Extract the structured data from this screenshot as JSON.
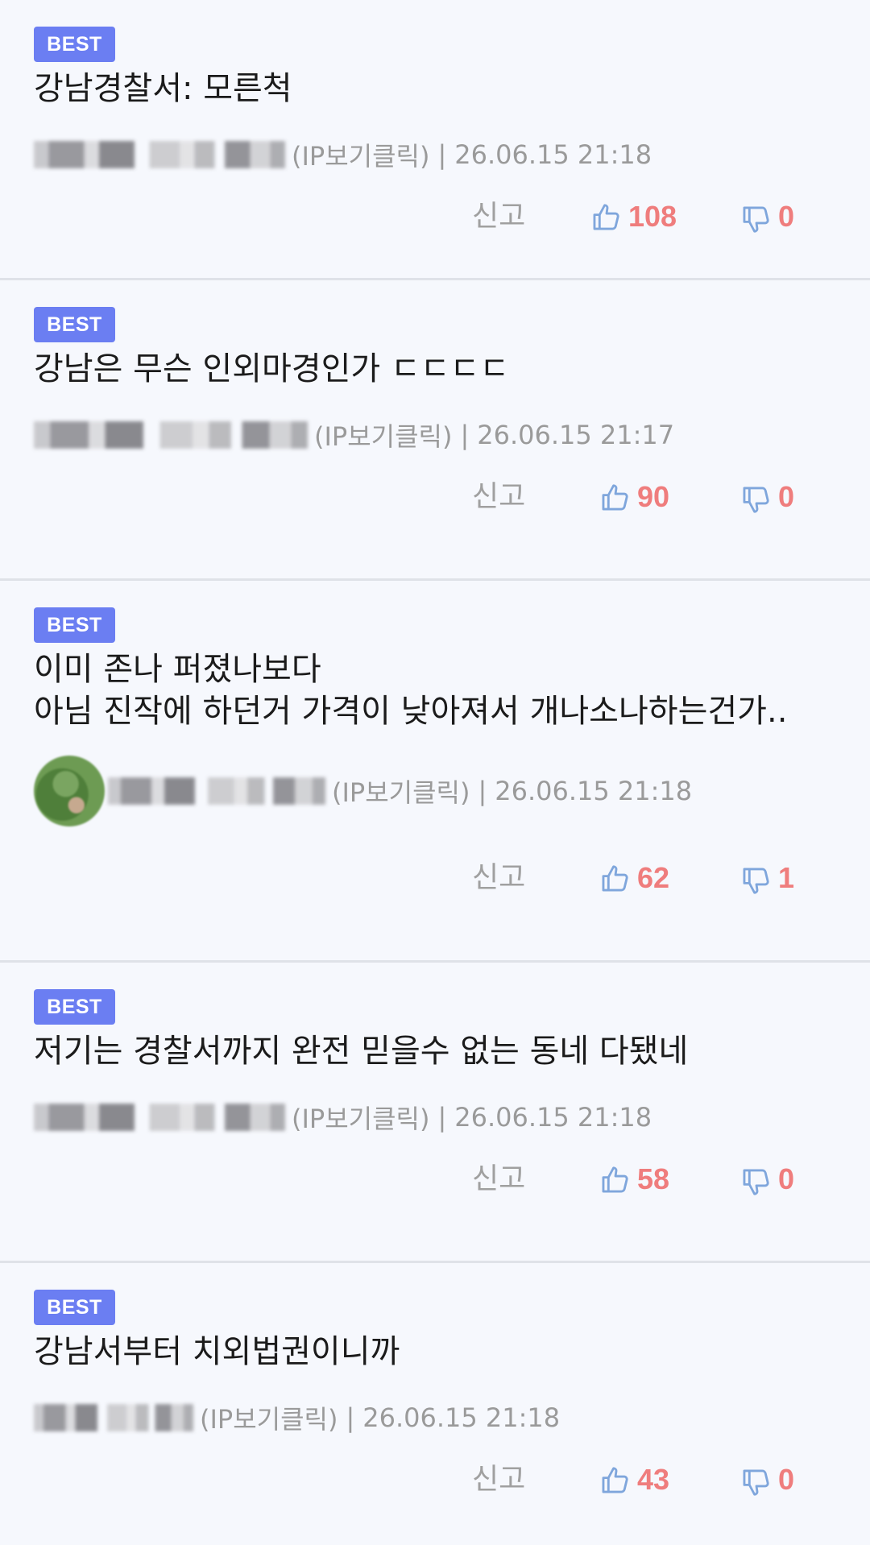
{
  "badge_label": "BEST",
  "report_label": "신고",
  "ip_label": "(IP보기클릭)",
  "separator": "|",
  "colors": {
    "badge": "#6b7ef2",
    "count": "#ef7d7d",
    "thumb_icon": "#7fa6dc",
    "meta_text": "#9a9a9a"
  },
  "comments": [
    {
      "lines": [
        "강남경찰서: 모른척"
      ],
      "date": "26.06.15 21:18",
      "likes": "108",
      "dislikes": "0"
    },
    {
      "lines": [
        "강남은 무슨 인외마경인가 ㄷㄷㄷㄷ"
      ],
      "date": "26.06.15 21:17",
      "likes": "90",
      "dislikes": "0"
    },
    {
      "lines": [
        "이미 존나 퍼졌나보다",
        "아님 진작에 하던거 가격이 낮아져서 개나소나하는건가.."
      ],
      "date": "26.06.15 21:18",
      "likes": "62",
      "dislikes": "1"
    },
    {
      "lines": [
        "저기는 경찰서까지 완전 믿을수 없는 동네 다됐네"
      ],
      "date": "26.06.15 21:18",
      "likes": "58",
      "dislikes": "0"
    },
    {
      "lines": [
        "강남서부터 치외법권이니까"
      ],
      "date": "26.06.15 21:18",
      "likes": "43",
      "dislikes": "0"
    }
  ]
}
